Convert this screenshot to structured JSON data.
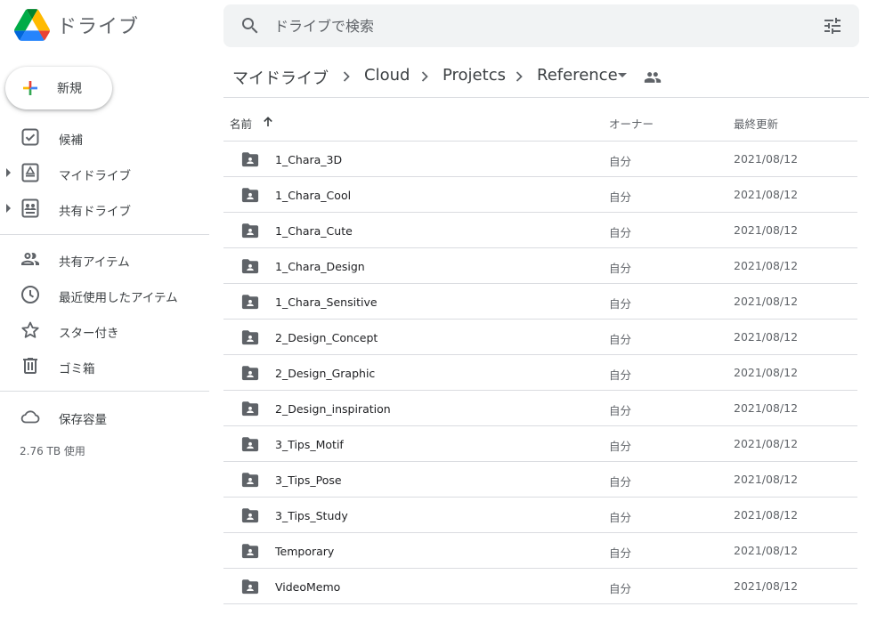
{
  "header": {
    "app_name": "ドライブ",
    "search_placeholder": "ドライブで検索"
  },
  "sidebar": {
    "new_label": "新規",
    "items": [
      {
        "label": "候補"
      },
      {
        "label": "マイドライブ"
      },
      {
        "label": "共有ドライブ"
      },
      {
        "label": "共有アイテム"
      },
      {
        "label": "最近使用したアイテム"
      },
      {
        "label": "スター付き"
      },
      {
        "label": "ゴミ箱"
      },
      {
        "label": "保存容量"
      }
    ],
    "storage_used": "2.76 TB 使用"
  },
  "breadcrumb": [
    "マイドライブ",
    "Cloud",
    "Projetcs",
    "Reference"
  ],
  "columns": {
    "name": "名前",
    "owner": "オーナー",
    "modified": "最終更新"
  },
  "files": [
    {
      "name": "1_Chara_3D",
      "owner": "自分",
      "modified": "2021/08/12"
    },
    {
      "name": "1_Chara_Cool",
      "owner": "自分",
      "modified": "2021/08/12"
    },
    {
      "name": "1_Chara_Cute",
      "owner": "自分",
      "modified": "2021/08/12"
    },
    {
      "name": "1_Chara_Design",
      "owner": "自分",
      "modified": "2021/08/12"
    },
    {
      "name": "1_Chara_Sensitive",
      "owner": "自分",
      "modified": "2021/08/12"
    },
    {
      "name": "2_Design_Concept",
      "owner": "自分",
      "modified": "2021/08/12"
    },
    {
      "name": "2_Design_Graphic",
      "owner": "自分",
      "modified": "2021/08/12"
    },
    {
      "name": "2_Design_inspiration",
      "owner": "自分",
      "modified": "2021/08/12"
    },
    {
      "name": "3_Tips_Motif",
      "owner": "自分",
      "modified": "2021/08/12"
    },
    {
      "name": "3_Tips_Pose",
      "owner": "自分",
      "modified": "2021/08/12"
    },
    {
      "name": "3_Tips_Study",
      "owner": "自分",
      "modified": "2021/08/12"
    },
    {
      "name": "Temporary",
      "owner": "自分",
      "modified": "2021/08/12"
    },
    {
      "name": "VideoMemo",
      "owner": "自分",
      "modified": "2021/08/12"
    }
  ],
  "icons": {
    "logo": "google-drive-logo",
    "search": "search-icon",
    "tune": "tune-icon",
    "folder": "shared-folder-icon",
    "sort": "arrow-up-icon"
  },
  "colors": {
    "drive_green": "#0f9d58",
    "drive_yellow": "#ffba00",
    "drive_blue": "#4285f4",
    "icon_gray": "#5f6368",
    "divider": "#dadce0",
    "search_bg": "#f1f3f4"
  }
}
